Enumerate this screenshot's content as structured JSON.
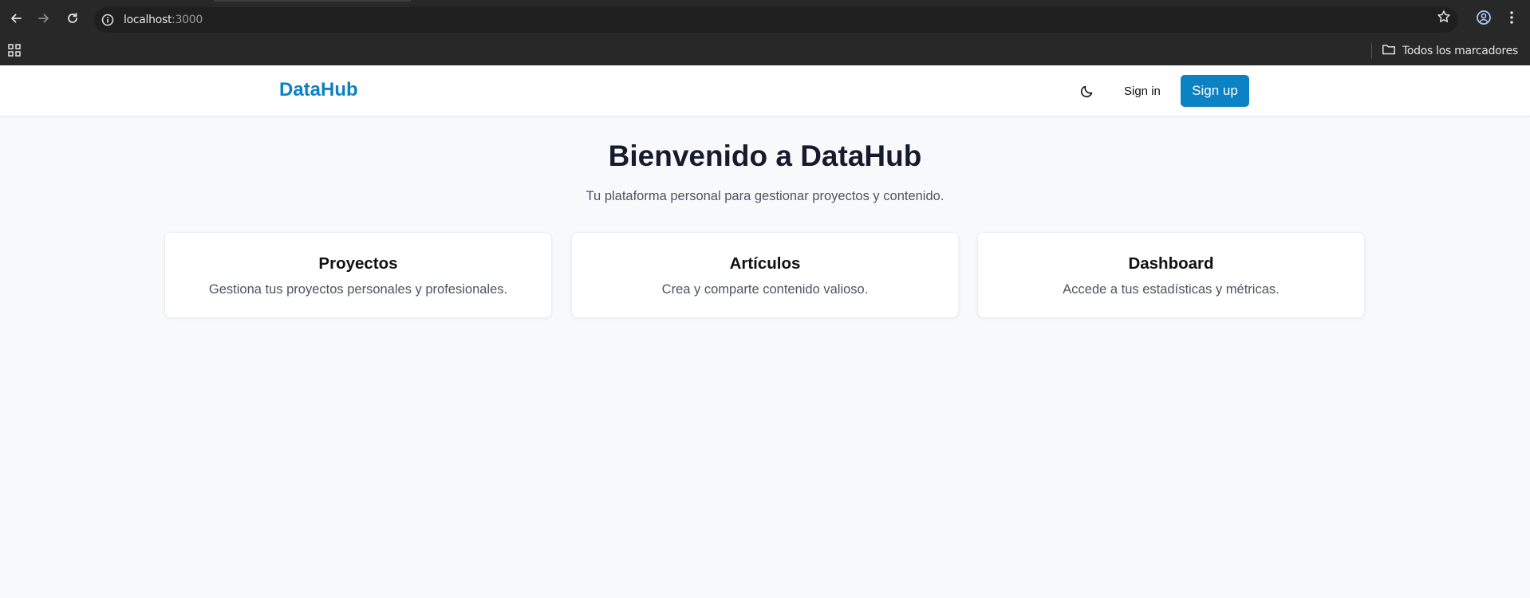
{
  "browser": {
    "url_host": "localhost",
    "url_port": ":3000",
    "bookmarks_folder": "Todos los marcadores",
    "icons": [
      "back-arrow-icon",
      "forward-arrow-icon",
      "reload-icon",
      "info-icon",
      "star-icon",
      "profile-icon",
      "kebab-menu-icon",
      "apps-grid-icon",
      "folder-icon"
    ]
  },
  "header": {
    "brand": "DataHub",
    "theme_icon": "moon-icon",
    "signin_label": "Sign in",
    "signup_label": "Sign up"
  },
  "hero": {
    "title": "Bienvenido a DataHub",
    "subtitle": "Tu plataforma personal para gestionar proyectos y contenido."
  },
  "cards": [
    {
      "title": "Proyectos",
      "description": "Gestiona tus proyectos personales y profesionales."
    },
    {
      "title": "Artículos",
      "description": "Crea y comparte contenido valioso."
    },
    {
      "title": "Dashboard",
      "description": "Accede a tus estadísticas y métricas."
    }
  ],
  "colors": {
    "brand": "#0a82c4",
    "page_bg": "#f8f9fb",
    "chrome_bg": "#282828",
    "title_text": "#141b2d",
    "muted_text": "#4b5563"
  }
}
